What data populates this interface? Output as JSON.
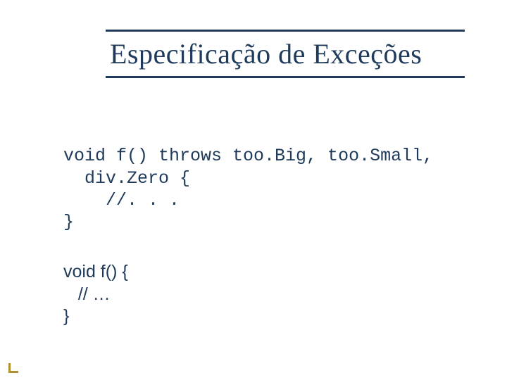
{
  "title": "Especificação de Exceções",
  "code1": {
    "line1": "void f() throws too.Big, too.Small,",
    "line2": "  div.Zero {",
    "line3": "    //. . .",
    "line4": "}"
  },
  "code2": {
    "line1": "void f() {",
    "line2": "   // …",
    "line3": "}"
  }
}
